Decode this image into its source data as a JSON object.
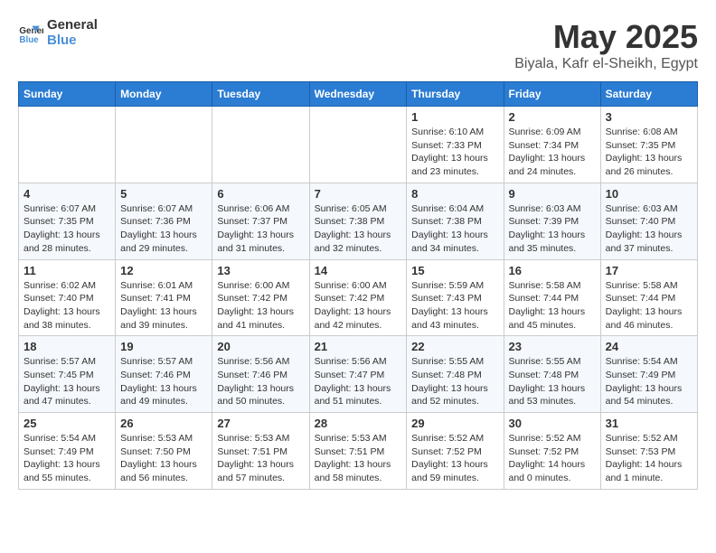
{
  "header": {
    "logo_line1": "General",
    "logo_line2": "Blue",
    "month": "May 2025",
    "location": "Biyala, Kafr el-Sheikh, Egypt"
  },
  "days_of_week": [
    "Sunday",
    "Monday",
    "Tuesday",
    "Wednesday",
    "Thursday",
    "Friday",
    "Saturday"
  ],
  "weeks": [
    [
      {
        "day": "",
        "info": ""
      },
      {
        "day": "",
        "info": ""
      },
      {
        "day": "",
        "info": ""
      },
      {
        "day": "",
        "info": ""
      },
      {
        "day": "1",
        "info": "Sunrise: 6:10 AM\nSunset: 7:33 PM\nDaylight: 13 hours\nand 23 minutes."
      },
      {
        "day": "2",
        "info": "Sunrise: 6:09 AM\nSunset: 7:34 PM\nDaylight: 13 hours\nand 24 minutes."
      },
      {
        "day": "3",
        "info": "Sunrise: 6:08 AM\nSunset: 7:35 PM\nDaylight: 13 hours\nand 26 minutes."
      }
    ],
    [
      {
        "day": "4",
        "info": "Sunrise: 6:07 AM\nSunset: 7:35 PM\nDaylight: 13 hours\nand 28 minutes."
      },
      {
        "day": "5",
        "info": "Sunrise: 6:07 AM\nSunset: 7:36 PM\nDaylight: 13 hours\nand 29 minutes."
      },
      {
        "day": "6",
        "info": "Sunrise: 6:06 AM\nSunset: 7:37 PM\nDaylight: 13 hours\nand 31 minutes."
      },
      {
        "day": "7",
        "info": "Sunrise: 6:05 AM\nSunset: 7:38 PM\nDaylight: 13 hours\nand 32 minutes."
      },
      {
        "day": "8",
        "info": "Sunrise: 6:04 AM\nSunset: 7:38 PM\nDaylight: 13 hours\nand 34 minutes."
      },
      {
        "day": "9",
        "info": "Sunrise: 6:03 AM\nSunset: 7:39 PM\nDaylight: 13 hours\nand 35 minutes."
      },
      {
        "day": "10",
        "info": "Sunrise: 6:03 AM\nSunset: 7:40 PM\nDaylight: 13 hours\nand 37 minutes."
      }
    ],
    [
      {
        "day": "11",
        "info": "Sunrise: 6:02 AM\nSunset: 7:40 PM\nDaylight: 13 hours\nand 38 minutes."
      },
      {
        "day": "12",
        "info": "Sunrise: 6:01 AM\nSunset: 7:41 PM\nDaylight: 13 hours\nand 39 minutes."
      },
      {
        "day": "13",
        "info": "Sunrise: 6:00 AM\nSunset: 7:42 PM\nDaylight: 13 hours\nand 41 minutes."
      },
      {
        "day": "14",
        "info": "Sunrise: 6:00 AM\nSunset: 7:42 PM\nDaylight: 13 hours\nand 42 minutes."
      },
      {
        "day": "15",
        "info": "Sunrise: 5:59 AM\nSunset: 7:43 PM\nDaylight: 13 hours\nand 43 minutes."
      },
      {
        "day": "16",
        "info": "Sunrise: 5:58 AM\nSunset: 7:44 PM\nDaylight: 13 hours\nand 45 minutes."
      },
      {
        "day": "17",
        "info": "Sunrise: 5:58 AM\nSunset: 7:44 PM\nDaylight: 13 hours\nand 46 minutes."
      }
    ],
    [
      {
        "day": "18",
        "info": "Sunrise: 5:57 AM\nSunset: 7:45 PM\nDaylight: 13 hours\nand 47 minutes."
      },
      {
        "day": "19",
        "info": "Sunrise: 5:57 AM\nSunset: 7:46 PM\nDaylight: 13 hours\nand 49 minutes."
      },
      {
        "day": "20",
        "info": "Sunrise: 5:56 AM\nSunset: 7:46 PM\nDaylight: 13 hours\nand 50 minutes."
      },
      {
        "day": "21",
        "info": "Sunrise: 5:56 AM\nSunset: 7:47 PM\nDaylight: 13 hours\nand 51 minutes."
      },
      {
        "day": "22",
        "info": "Sunrise: 5:55 AM\nSunset: 7:48 PM\nDaylight: 13 hours\nand 52 minutes."
      },
      {
        "day": "23",
        "info": "Sunrise: 5:55 AM\nSunset: 7:48 PM\nDaylight: 13 hours\nand 53 minutes."
      },
      {
        "day": "24",
        "info": "Sunrise: 5:54 AM\nSunset: 7:49 PM\nDaylight: 13 hours\nand 54 minutes."
      }
    ],
    [
      {
        "day": "25",
        "info": "Sunrise: 5:54 AM\nSunset: 7:49 PM\nDaylight: 13 hours\nand 55 minutes."
      },
      {
        "day": "26",
        "info": "Sunrise: 5:53 AM\nSunset: 7:50 PM\nDaylight: 13 hours\nand 56 minutes."
      },
      {
        "day": "27",
        "info": "Sunrise: 5:53 AM\nSunset: 7:51 PM\nDaylight: 13 hours\nand 57 minutes."
      },
      {
        "day": "28",
        "info": "Sunrise: 5:53 AM\nSunset: 7:51 PM\nDaylight: 13 hours\nand 58 minutes."
      },
      {
        "day": "29",
        "info": "Sunrise: 5:52 AM\nSunset: 7:52 PM\nDaylight: 13 hours\nand 59 minutes."
      },
      {
        "day": "30",
        "info": "Sunrise: 5:52 AM\nSunset: 7:52 PM\nDaylight: 14 hours\nand 0 minutes."
      },
      {
        "day": "31",
        "info": "Sunrise: 5:52 AM\nSunset: 7:53 PM\nDaylight: 14 hours\nand 1 minute."
      }
    ]
  ]
}
